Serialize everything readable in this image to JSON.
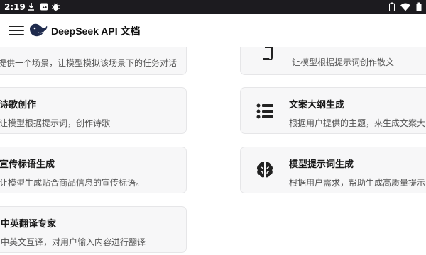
{
  "status_bar": {
    "time": "2:19",
    "icons": [
      "download-icon",
      "image-icon",
      "bug-icon",
      "battery-icon",
      "wifi-icon",
      "battery-full-icon"
    ]
  },
  "app_bar": {
    "title": "DeepSeek API 文档",
    "menu_icon": "hamburger-menu-icon",
    "logo_icon": "deepseek-whale-logo"
  },
  "cards": [
    {
      "title": "",
      "desc": "提供一个场景，让模型模拟该场景下的任务对话",
      "icon": ""
    },
    {
      "title": "",
      "desc": "让模型根据提示词创作散文",
      "icon": "scroll-icon"
    },
    {
      "title": "诗歌创作",
      "desc": "让模型根据提示词，创作诗歌",
      "icon": ""
    },
    {
      "title": "文案大纲生成",
      "desc": "根据用户提供的主题，来生成文案大",
      "icon": "list-icon"
    },
    {
      "title": "宣传标语生成",
      "desc": "让模型生成贴合商品信息的宣传标语。",
      "icon": ""
    },
    {
      "title": "模型提示词生成",
      "desc": "根据用户需求，帮助生成高质量提示",
      "icon": "brain-icon"
    },
    {
      "title": "中英翻译专家",
      "desc": "中英文互译，对用户输入内容进行翻译",
      "icon": ""
    }
  ],
  "colors": {
    "status_bar_bg": "#1c1b1f",
    "card_bg": "#f7f7f8",
    "icon_color": "#222222"
  }
}
